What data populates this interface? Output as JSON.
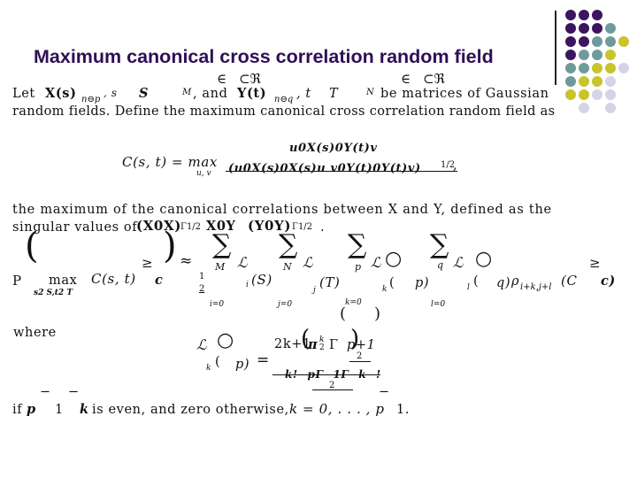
{
  "slide": {
    "title": "Maximum canonical cross correlation random field",
    "decoration": {
      "dot_colors": {
        "P": "#3b1560",
        "T": "#6f9a9c",
        "Y": "#c8c42a",
        "L": "#d4d4e6"
      },
      "dot_grid": [
        [
          "P",
          "P",
          "P",
          "",
          ""
        ],
        [
          "P",
          "P",
          "P",
          "T",
          ""
        ],
        [
          "P",
          "P",
          "T",
          "T",
          "Y"
        ],
        [
          "P",
          "T",
          "T",
          "Y",
          ""
        ],
        [
          "T",
          "T",
          "Y",
          "Y",
          "L"
        ],
        [
          "T",
          "Y",
          "Y",
          "L",
          ""
        ],
        [
          "Y",
          "Y",
          "L",
          "L",
          ""
        ],
        [
          "",
          "L",
          "",
          "L",
          ""
        ]
      ]
    }
  },
  "intro": {
    "sym_in_1": "∈",
    "sym_sub_1": "⊂ℜ",
    "sym_in_2": "∈",
    "sym_sub_2": "⊂ℜ",
    "let": "Let",
    "X_s": "X(s)",
    "sub_np": "n⊖p",
    "comma_s": ", s",
    "S": "S",
    "M": "M",
    "and": ", and",
    "Y_t": "Y(t)",
    "sub_nq": "n⊖q",
    "comma_t": ", t",
    "T": "T",
    "N": "N",
    "be_matrices": "be matrices of Gaussian",
    "line2": "random fields. Define the maximum canonical cross correlation random field as"
  },
  "definition": {
    "lhs": "C(s, t) = max",
    "under_max": "u, v",
    "numerator": "u0X(s)0Y(t)v",
    "denominator": "(u0X(s)0X(s)u  v0Y(t)0Y(t)v)",
    "exponent": "1/2",
    "trailing": ","
  },
  "explanation": {
    "line1": "the maximum of the canonical correlations between X and Y, defined as the",
    "line2_a": "singular values of ",
    "line2_b": "(X0X)",
    "line2_c": "Γ1/2",
    "line2_d": "X0Y",
    "line2_e": "(Y0Y)",
    "line2_f": "Γ1/2",
    "line2_g": "."
  },
  "formula": {
    "P": "P",
    "max": "max",
    "max_sub": "s2 S,t2 T",
    "C": "C(s, t)",
    "geq": "≥",
    "c": "c",
    "approx": "≈",
    "half_num": "1",
    "half_den": "2",
    "sigma": "∑",
    "M": "M",
    "N": "N",
    "p": "p",
    "q": "q",
    "L": "ℒ",
    "sub_i": "i",
    "S_arg": "(S)",
    "sub_j": "j",
    "T_arg": "(T)",
    "i0": "i=0",
    "j0": "j=0",
    "k0": "k=0",
    "l0": "l=0",
    "circle": "○",
    "sub_k": "k",
    "paren_open": "(",
    "p_close": "p)",
    "sub_l": "l",
    "q_close": "q)",
    "rho": "ρ",
    "rho_sub": "i+k,j+l",
    "C_open": "(C",
    "c_close": "c)",
    "geq_end": "≥"
  },
  "where": {
    "label": "where",
    "L": "ℒ",
    "circle": "○",
    "sub_k": "k",
    "paren_open": "(",
    "p_close": "p)",
    "eq": "=",
    "num": "2k+1",
    "num_pi": "π",
    "num_k2": "k",
    "num_2": "2",
    "num_gamma": "Γ",
    "num_p1": "p+1",
    "num_half": "2",
    "den": "k!   pΓ 1Γ k   !",
    "den_2": "2",
    "minus": "−"
  },
  "condition": {
    "text_if": "if",
    "p": "p",
    "one": "1",
    "k": "k",
    "rest": "is even, and zero otherwise,",
    "k_eq": "k = 0, . . . , p",
    "end": "1.",
    "minus": "−"
  }
}
